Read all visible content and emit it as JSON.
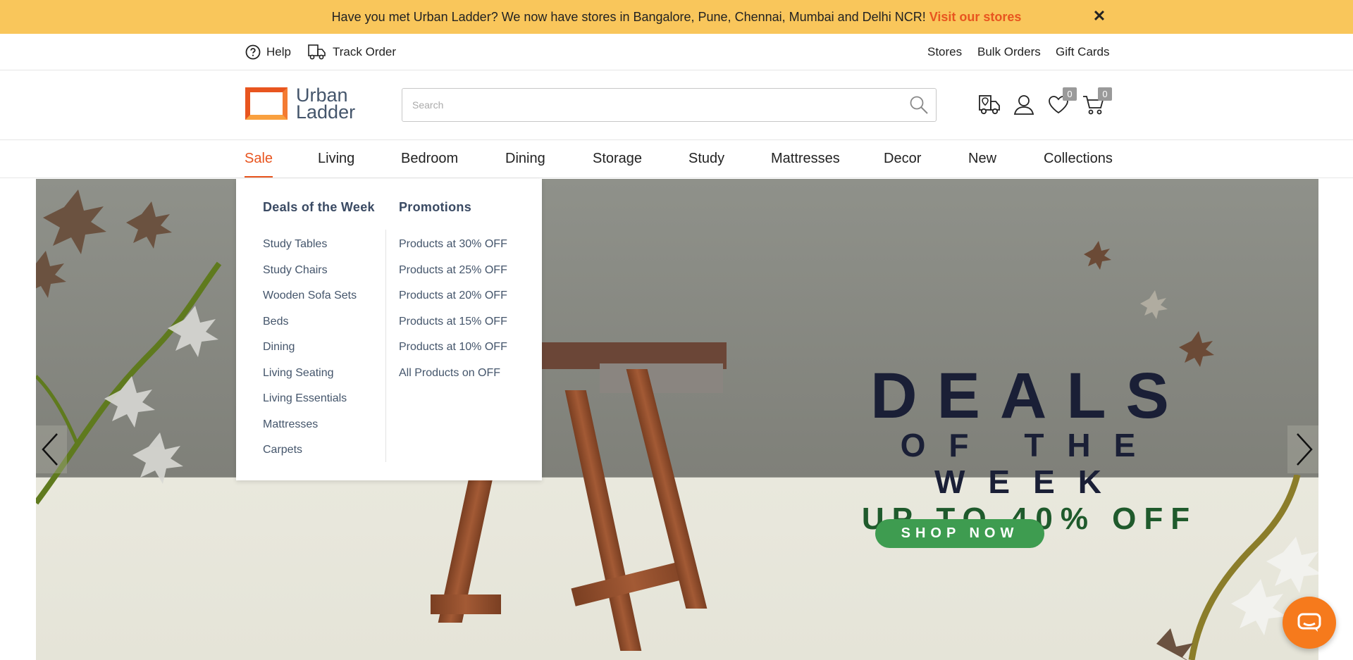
{
  "announcement": {
    "text": "Have you met Urban Ladder? We now have stores in Bangalore, Pune, Chennai, Mumbai and Delhi NCR!",
    "link": "Visit our stores"
  },
  "utility": {
    "help": "Help",
    "track_order": "Track Order",
    "stores": "Stores",
    "bulk_orders": "Bulk Orders",
    "gift_cards": "Gift Cards"
  },
  "header": {
    "logo_line1": "Urban",
    "logo_line2": "Ladder",
    "search_placeholder": "Search",
    "wishlist_count": "0",
    "cart_count": "0"
  },
  "nav": [
    "Sale",
    "Living",
    "Bedroom",
    "Dining",
    "Storage",
    "Study",
    "Mattresses",
    "Decor",
    "New",
    "Collections"
  ],
  "dropdown": {
    "col1_title": "Deals of the Week",
    "col1_items": [
      "Study Tables",
      "Study Chairs",
      "Wooden Sofa Sets",
      "Beds",
      "Dining",
      "Living Seating",
      "Living Essentials",
      "Mattresses",
      "Carpets"
    ],
    "col2_title": "Promotions",
    "col2_items": [
      "Products at 30% OFF",
      "Products at 25% OFF",
      "Products at 20% OFF",
      "Products at 15% OFF",
      "Products at 10% OFF",
      "All Products on OFF"
    ]
  },
  "hero": {
    "line1": "DEALS",
    "line2": "OF THE WEEK",
    "line3": "UP TO 40% OFF",
    "cta": "SHOP NOW"
  },
  "colors": {
    "accent": "#e8551f",
    "announce_bg": "#f9c65b",
    "cta_green": "#3e9c50"
  }
}
